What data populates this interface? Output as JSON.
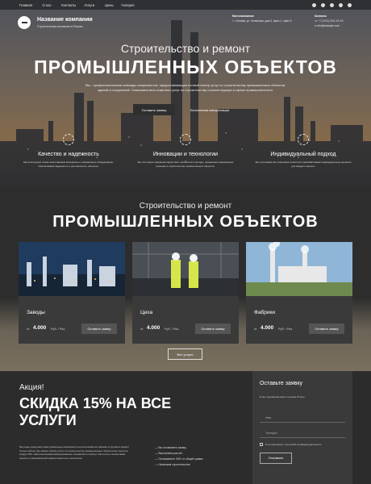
{
  "nav": {
    "items": [
      "Главная ·",
      "О нас ·",
      "Контакты",
      "Услуги ·",
      "Цены",
      "Галерея"
    ]
  },
  "header": {
    "company_name": "Название компании",
    "company_sub": "Строительная компания в России",
    "address_label": "Местоположение",
    "address": "г. Москва, ул. Ленинская, дом 6, офис 1, офис 8",
    "contacts_label": "Контакты",
    "phone": "+7 (XXX) XXX-XX-XX",
    "email": "info@example.com"
  },
  "hero": {
    "title1": "Строительство и ремонт",
    "title2": "ПРОМЫШЛЕННЫХ ОБЪЕКТОВ",
    "description": "Мы - профессиональная команда специалистов, предоставляющая полный спектр услуг по строительству промышленных объектов, зданий и сооружений. Оказываем весь комплекс услуг по строительству и реконструкции в сфере промышленности.",
    "primary_button": "Оставить заявку",
    "secondary_button": "Бесплатная консультация",
    "features": [
      {
        "title": "Качество и надежность",
        "text": "Мы используем только качественные материалы и современное оборудование, обеспечиваем надежность и долговечность объектов."
      },
      {
        "title": "Инновации и технологии",
        "text": "Мы постоянно совершенствуем свои технологии и методы, применяем современные решения в строительстве промышленных объектов."
      },
      {
        "title": "Индивидуальный подход",
        "text": "Мы учитываем все пожелания клиентов и разрабатываем индивидуальные решения для каждого проекта."
      }
    ]
  },
  "services": {
    "title1": "Строительство и ремонт",
    "title2": "ПРОМЫШЛЕННЫХ ОБЪЕКТОВ",
    "cards": [
      {
        "name": "Заводы",
        "from": "от",
        "price": "4.000",
        "unit": "Руб. / Раз.",
        "button": "Оставить заявку"
      },
      {
        "name": "Цеха",
        "from": "от",
        "price": "4.000",
        "unit": "Руб. / Раз.",
        "button": "Оставить заявку"
      },
      {
        "name": "Фабрики",
        "from": "от",
        "price": "4.000",
        "unit": "Руб. / Раз.",
        "button": "Оставить заявку"
      }
    ],
    "all_button": "Все услуги"
  },
  "promo": {
    "label": "Акция!",
    "title": "СКИДКА 15% НА ВСЕ УСЛУГИ",
    "text": "Мы рады предложить вам уникальную возможность воспользоваться нашими услугами в кредит! Только сейчас при заказе любой услуги по строительству промышленных объектов вы получите скидку 15%. Наши высококвалифицированные специалисты помогут воплотить в жизнь ваши проекты с максимальной эффективностью и качеством.",
    "list": [
      "— Вы оставляете заявку",
      "— Выполняем расчёт",
      "— Оплачиваете 30% от общей суммы",
      "— Начинаем строительство"
    ]
  },
  "form": {
    "title": "Оставьте заявку",
    "subtitle": "И мы перезвоним вам в течение 15 мин",
    "name_placeholder": "Имя",
    "phone_placeholder": "Телефон",
    "consent": "Я согласен(на) с политикой конфиденциальности",
    "button": "Отправить"
  },
  "colors": {
    "dark_bg": "#2b2b2b",
    "card_bg": "#3a3a3a",
    "button_bg": "#555555"
  }
}
